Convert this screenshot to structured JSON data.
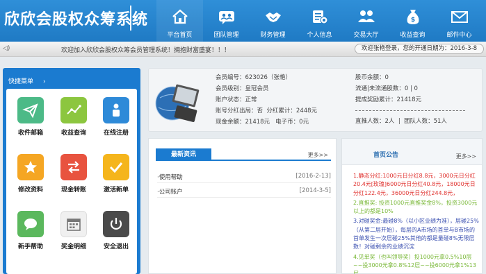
{
  "brand": {
    "title": "欣欣会股权众筹系统"
  },
  "nav": [
    {
      "label": "平台首页",
      "icon": "home-icon"
    },
    {
      "label": "团队管理",
      "icon": "team-chat-icon"
    },
    {
      "label": "财务管理",
      "icon": "handshake-icon"
    },
    {
      "label": "个人信息",
      "icon": "profile-settings-icon"
    },
    {
      "label": "交易大厅",
      "icon": "users-group-icon"
    },
    {
      "label": "收益查询",
      "icon": "money-bag-icon"
    },
    {
      "label": "邮件中心",
      "icon": "envelope-icon"
    }
  ],
  "notice": {
    "text": "欢迎加入欣欣会股权众筹会员管理系统！拥抱财富盛宴！！！",
    "welcome": "欢迎张艳登录，您的开通日期为：2016-3-8"
  },
  "sidebar": {
    "title": "快捷菜单",
    "arrow": "›",
    "tiles": [
      {
        "label": "收件邮箱",
        "icon": "paper-plane-icon",
        "color": "#4cba87"
      },
      {
        "label": "收益查询",
        "icon": "trend-line-icon",
        "color": "#8cc63f"
      },
      {
        "label": "在线注册",
        "icon": "person-icon",
        "color": "#2e8ad8"
      },
      {
        "label": "修改资料",
        "icon": "star-icon",
        "color": "#f5a623"
      },
      {
        "label": "现金转账",
        "icon": "transfer-arrows-icon",
        "color": "#e8533f"
      },
      {
        "label": "激活新单",
        "icon": "check-icon",
        "color": "#f5b51c"
      },
      {
        "label": "新手帮助",
        "icon": "chat-bubble-icon",
        "color": "#5bb85d"
      },
      {
        "label": "奖金明细",
        "icon": "calendar-icon",
        "color": "#dcdcdc"
      },
      {
        "label": "安全退出",
        "icon": "power-icon",
        "color": "#4a4a4a"
      }
    ]
  },
  "profile": {
    "member_no": "会员编号：623026（张艳）",
    "member_level": "会员级别：皇冠会员",
    "account_status": "账户状态：正常",
    "sell_line_left": "账号分红出局：否",
    "sell_line_right": "分红累计：2448元",
    "cash_left": "现金余额：21418元",
    "cash_right": "电子币：0元",
    "stock_balance": "股币余额：0",
    "circulation": "流通|未流通股数：0 | 0",
    "withdraw_total": "提成奖励累计：21418元",
    "direct_left": "直推人数：2人",
    "direct_right": "团队人数：51人",
    "dash_line": "----------------------------------------------"
  },
  "news": {
    "tab": "最新资讯",
    "more": "更多>>",
    "items": [
      {
        "title": "·使用帮助",
        "date": "[2016-2-13]"
      },
      {
        "title": "·公司账户",
        "date": "[2014-3-5]"
      }
    ]
  },
  "announcement": {
    "title": "首页公告",
    "more": "更多>>",
    "paragraphs": [
      {
        "text": "1.静态分红:1000元日分红8.8元，3000元日分红20.4元[玫瑰]6000元日分红40.8元，18000元日分红122.4元，36000元日分红244.8元，",
        "color": "#e0322f"
      },
      {
        "text": "2.直推奖: 投资1000元直推奖金8%，投资3000元以上的都是10%",
        "color": "#7ab838"
      },
      {
        "text": "3.对碰奖金:最碰8%（以小区业绩为准），层碰25%（从第二层开始），每层的A市场的首单与B市场的首单发生一次层碰25%其他的都是量碰8%无限层数！对碰剩余的业绩沉淀",
        "color": "#3a4fb0"
      },
      {
        "text": "4.见单奖（也叫领导奖）投1000元拿0.5%10层~~投3000元拿0.8%12层~~投6000元拿1%13层",
        "color": "#7ab838"
      }
    ]
  }
}
